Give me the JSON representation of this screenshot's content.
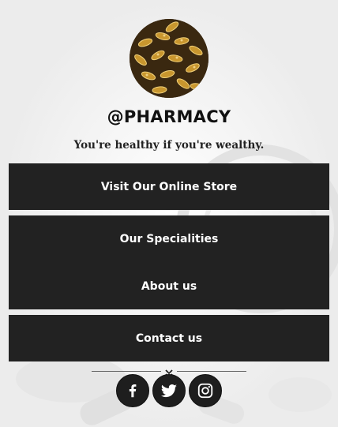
{
  "profile": {
    "handle": "@PHARMACY",
    "tagline": "You're healthy if you're wealthy."
  },
  "links": [
    {
      "label": "Visit Our Online Store"
    },
    {
      "label": "Our Specialities"
    },
    {
      "label": "About us"
    },
    {
      "label": "Contact us"
    }
  ],
  "social": [
    {
      "icon": "facebook-icon"
    },
    {
      "icon": "twitter-icon"
    },
    {
      "icon": "instagram-icon"
    }
  ],
  "colors": {
    "button_bg": "#222222",
    "button_text": "#ffffff",
    "page_bg": "#f2f2f2"
  }
}
